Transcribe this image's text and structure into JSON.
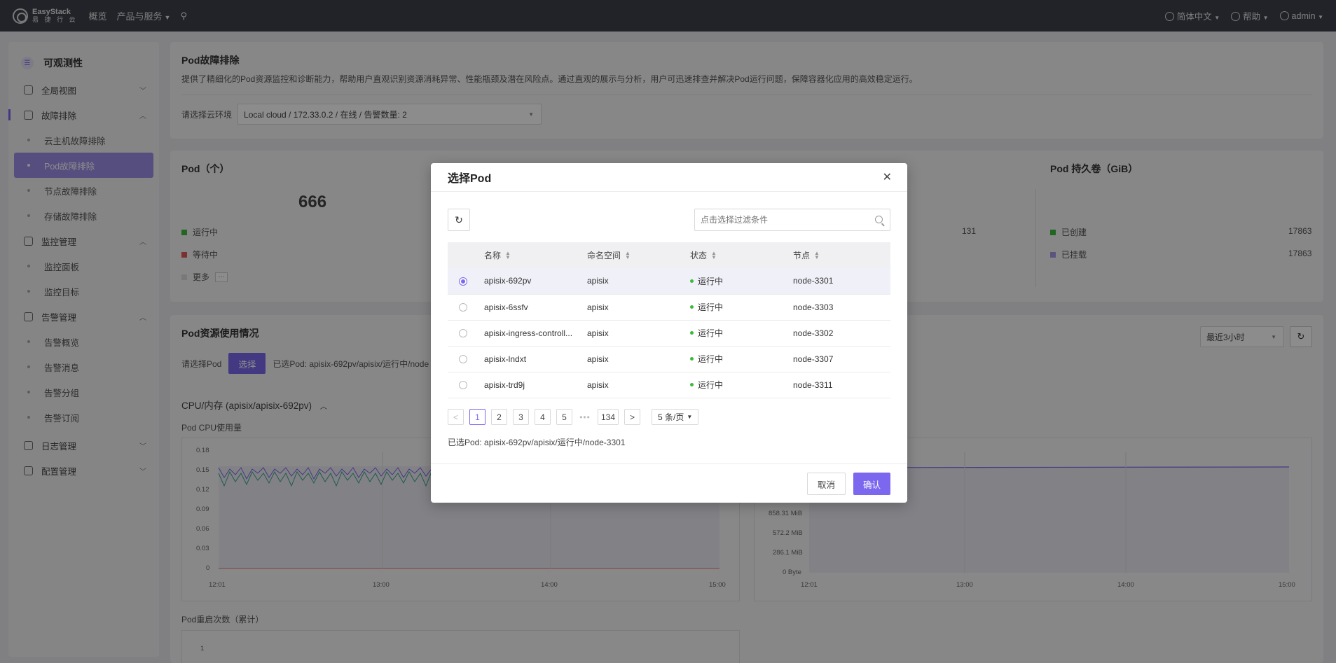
{
  "topbar": {
    "logo_name": "EasyStack",
    "logo_sub": "易 捷 行 云",
    "nav_overview": "概览",
    "nav_products": "产品与服务",
    "lang": "简体中文",
    "help": "帮助",
    "user": "admin"
  },
  "sidebar": {
    "title": "可观测性",
    "groups": [
      {
        "label": "全局视图"
      },
      {
        "label": "故障排除",
        "items": [
          "云主机故障排除",
          "Pod故障排除",
          "节点故障排除",
          "存储故障排除"
        ]
      },
      {
        "label": "监控管理",
        "items": [
          "监控面板",
          "监控目标"
        ]
      },
      {
        "label": "告警管理",
        "items": [
          "告警概览",
          "告警消息",
          "告警分组",
          "告警订阅"
        ]
      },
      {
        "label": "日志管理"
      },
      {
        "label": "配置管理"
      }
    ]
  },
  "header": {
    "title": "Pod故障排除",
    "desc": "提供了精细化的Pod资源监控和诊断能力，帮助用户直观识别资源消耗异常、性能瓶颈及潜在风险点。通过直观的展示与分析，用户可迅速排查并解决Pod运行问题，保障容器化应用的高效稳定运行。",
    "env_label": "请选择云环境",
    "env_value": "Local cloud / 172.33.0.2 / 在线 / 告警数量: 2"
  },
  "stats": {
    "pod_title": "Pod（个）",
    "pod_total": "666",
    "running": "运行中",
    "waiting": "等待中",
    "more": "更多",
    "more_btn": "···",
    "mid_value": "131",
    "vol_title": "Pod 持久卷（GiB）",
    "created": "已创建",
    "created_val": "17863",
    "mounted": "已挂载",
    "mounted_val": "17863"
  },
  "usage": {
    "title": "Pod资源使用情况",
    "select_label": "请选择Pod",
    "select_btn": "选择",
    "selected": "已选Pod:  apisix-692pv/apisix/运行中/node",
    "time_range": "最近3小时",
    "section": "CPU/内存 (apisix/apisix-692pv)",
    "cpu_title": "Pod CPU使用量",
    "cpu_y": [
      "0.18",
      "0.15",
      "0.12",
      "0.09",
      "0.06",
      "0.03",
      "0"
    ],
    "mem_y": [
      "858.31 MiB",
      "572.2 MiB",
      "286.1 MiB",
      "0 Byte"
    ],
    "x_ticks": [
      "12:01",
      "13:00",
      "14:00",
      "15:00"
    ],
    "restart_title": "Pod重启次数（累计）",
    "restart_y": "1"
  },
  "modal": {
    "title": "选择Pod",
    "filter_placeholder": "点击选择过滤条件",
    "columns": [
      "名称",
      "命名空间",
      "状态",
      "节点"
    ],
    "rows": [
      {
        "name": "apisix-692pv",
        "ns": "apisix",
        "status": "运行中",
        "node": "node-3301"
      },
      {
        "name": "apisix-6ssfv",
        "ns": "apisix",
        "status": "运行中",
        "node": "node-3303"
      },
      {
        "name": "apisix-ingress-controll...",
        "ns": "apisix",
        "status": "运行中",
        "node": "node-3302"
      },
      {
        "name": "apisix-lndxt",
        "ns": "apisix",
        "status": "运行中",
        "node": "node-3307"
      },
      {
        "name": "apisix-trd9j",
        "ns": "apisix",
        "status": "运行中",
        "node": "node-3311"
      }
    ],
    "pages": [
      "1",
      "2",
      "3",
      "4",
      "5"
    ],
    "ellipsis": "•••",
    "last_page": "134",
    "page_size": "5 条/页",
    "selected": "已选Pod:  apisix-692pv/apisix/运行中/node-3301",
    "cancel": "取消",
    "confirm": "确认"
  },
  "colors": {
    "accent": "#7b68ee",
    "running": "#3cba3c",
    "waiting": "#e05a5a",
    "series2": "#3aa58a"
  }
}
